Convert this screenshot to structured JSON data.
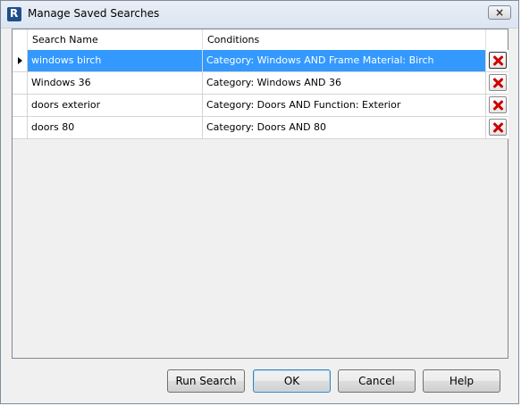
{
  "window": {
    "title": "Manage Saved Searches",
    "close_symbol": "×"
  },
  "grid": {
    "columns": [
      "Search Name",
      "Conditions"
    ],
    "rows": [
      {
        "name": "windows birch",
        "conditions": "Category: Windows AND Frame Material: Birch",
        "selected": true
      },
      {
        "name": "Windows 36",
        "conditions": "Category: Windows AND 36",
        "selected": false
      },
      {
        "name": "doors exterior",
        "conditions": "Category: Doors AND Function: Exterior",
        "selected": false
      },
      {
        "name": "doors 80",
        "conditions": "Category: Doors AND 80",
        "selected": false
      }
    ]
  },
  "buttons": {
    "run_search": "Run Search",
    "ok": "OK",
    "cancel": "Cancel",
    "help": "Help"
  },
  "colors": {
    "selection": "#3399ff",
    "delete_icon": "#cc0000"
  },
  "icons": {
    "app": "revit-logo-icon",
    "row_pointer": "row-pointer-icon",
    "delete": "delete-x-icon"
  }
}
